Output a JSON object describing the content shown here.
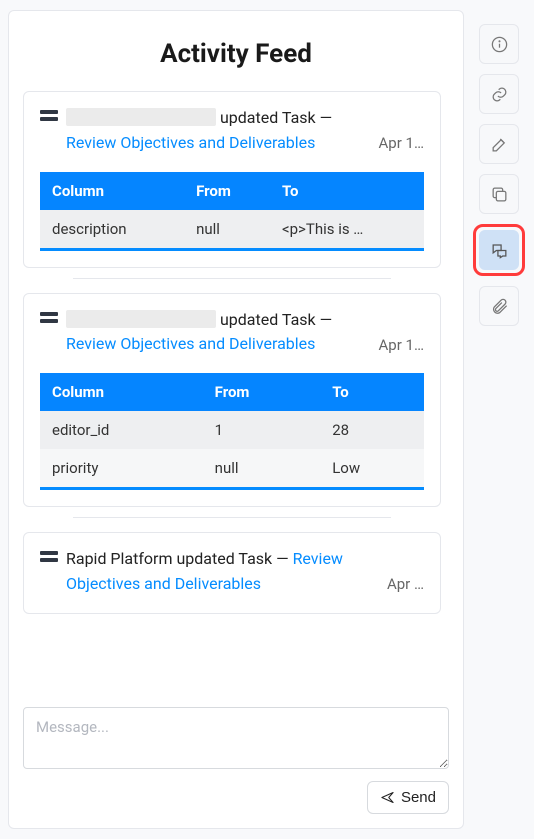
{
  "title": "Activity Feed",
  "table_headers": {
    "col": "Column",
    "from": "From",
    "to": "To"
  },
  "entries": [
    {
      "actor_redacted": true,
      "actor": "",
      "action": "updated Task",
      "dash": "—",
      "link": "Review Objectives and Deliverables",
      "timestamp": "Apr 1…",
      "changes": [
        {
          "column": "description",
          "from": "null",
          "to": "<p>This is …"
        }
      ]
    },
    {
      "actor_redacted": true,
      "actor": "",
      "action": "updated Task",
      "dash": "—",
      "link": "Review Objectives and Deliverables",
      "timestamp": "Apr 1…",
      "changes": [
        {
          "column": "editor_id",
          "from": "1",
          "to": "28"
        },
        {
          "column": "priority",
          "from": "null",
          "to": "Low"
        }
      ]
    },
    {
      "actor_redacted": false,
      "actor": "Rapid Platform",
      "action": "updated Task",
      "dash": "—",
      "link": "Review Objectives and Deliverables",
      "timestamp": "Apr …",
      "changes": []
    }
  ],
  "compose": {
    "placeholder": "Message...",
    "send": "Send"
  },
  "rail": {
    "info": "info-icon",
    "link": "link-icon",
    "edit": "edit-note-icon",
    "copy": "copy-icon",
    "chat": "chat-icon",
    "attach": "paperclip-icon"
  },
  "colors": {
    "accent": "#058cff",
    "header_blue": "#0585ff",
    "highlight_border": "#ff3b3b"
  }
}
